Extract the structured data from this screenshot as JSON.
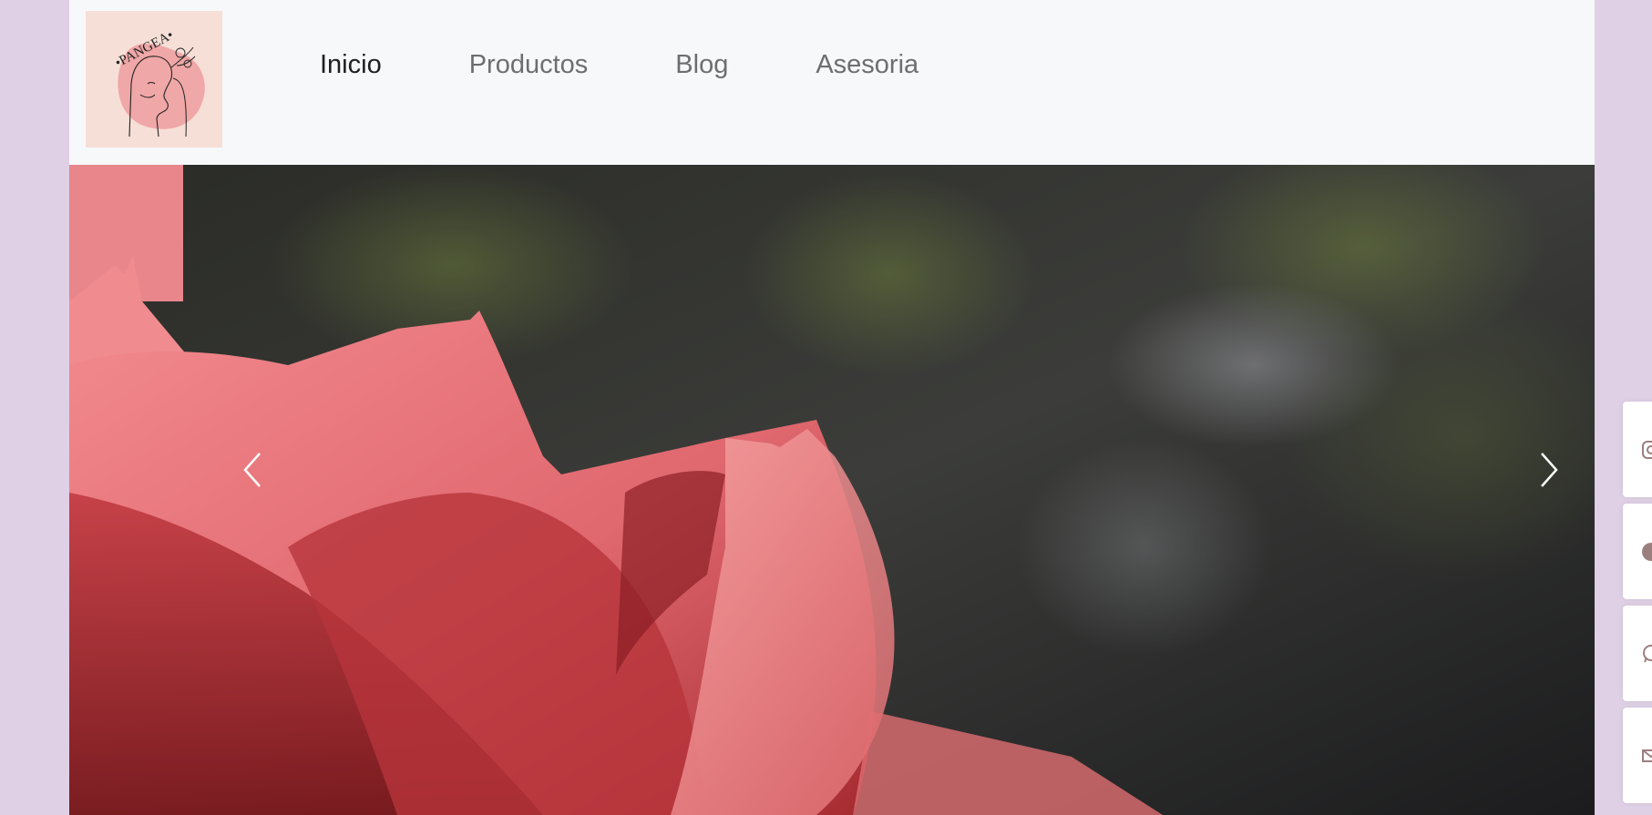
{
  "logo": {
    "text": "•PANGEA•",
    "accent_color": "#f0a7a7",
    "background_color": "#f6dfd7"
  },
  "nav": {
    "items": [
      {
        "label": "Inicio",
        "active": true
      },
      {
        "label": "Productos",
        "active": false
      },
      {
        "label": "Blog",
        "active": false
      },
      {
        "label": "Asesoria",
        "active": false
      }
    ]
  },
  "carousel": {
    "prev_icon": "chevron-left-icon",
    "next_icon": "chevron-right-icon"
  },
  "social": [
    {
      "icon": "instagram-icon"
    },
    {
      "icon": "facebook-icon"
    },
    {
      "icon": "whatsapp-icon"
    },
    {
      "icon": "email-icon"
    }
  ],
  "colors": {
    "page_background": "#dfd0e6",
    "navbar_background": "#f7f8fa",
    "social_icon_color": "#9b7f7f"
  }
}
